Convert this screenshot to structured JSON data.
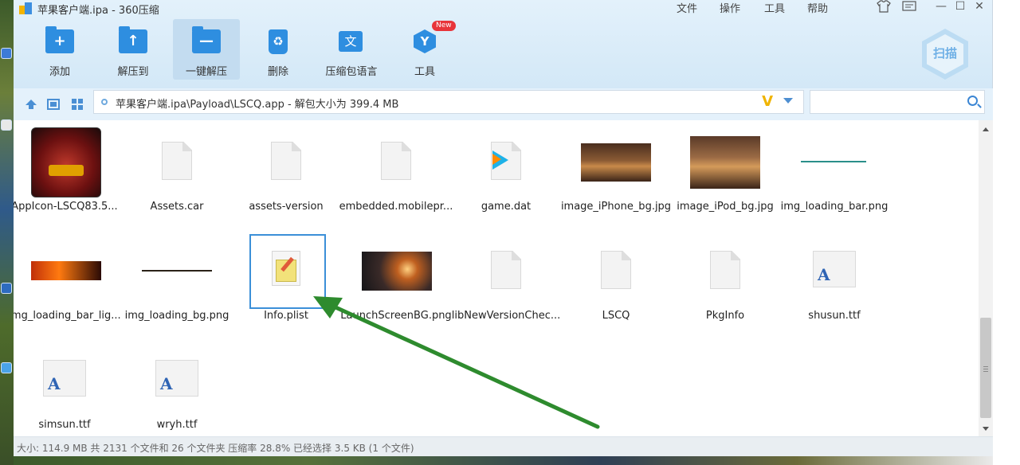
{
  "window": {
    "title": "苹果客户端.ipa - 360压缩",
    "menu": [
      "文件",
      "操作",
      "工具",
      "帮助"
    ]
  },
  "toolbar": {
    "items": [
      {
        "label": "添加",
        "icon": "add-folder-icon",
        "symbol": "+"
      },
      {
        "label": "解压到",
        "icon": "extract-to-icon",
        "symbol": "↑"
      },
      {
        "label": "一键解压",
        "icon": "one-click-extract-icon",
        "symbol": "—"
      },
      {
        "label": "删除",
        "icon": "delete-icon",
        "symbol": "♻"
      },
      {
        "label": "压缩包语言",
        "icon": "language-icon",
        "symbol": "文"
      },
      {
        "label": "工具",
        "icon": "tools-icon",
        "symbol": "Y",
        "badge": "New"
      }
    ],
    "scan_label": "扫描"
  },
  "address": {
    "path": "苹果客户端.ipa\\Payload\\LSCQ.app - 解包大小为 399.4 MB",
    "search_placeholder": ""
  },
  "files": [
    {
      "name": "AppIcon-LSCQ83.5...",
      "type": "app-icon"
    },
    {
      "name": "Assets.car",
      "type": "doc"
    },
    {
      "name": "assets-version",
      "type": "doc"
    },
    {
      "name": "embedded.mobilepr...",
      "type": "doc"
    },
    {
      "name": "game.dat",
      "type": "vcd"
    },
    {
      "name": "image_iPhone_bg.jpg",
      "type": "image"
    },
    {
      "name": "image_iPod_bg.jpg",
      "type": "image"
    },
    {
      "name": "img_loading_bar.png",
      "type": "bar-teal"
    },
    {
      "name": "img_loading_bar_lig...",
      "type": "bar-light"
    },
    {
      "name": "img_loading_bg.png",
      "type": "bar-dark"
    },
    {
      "name": "Info.plist",
      "type": "plist",
      "selected": true
    },
    {
      "name": "LaunchScreenBG.png",
      "type": "launch"
    },
    {
      "name": "libNewVersionChec...",
      "type": "doc"
    },
    {
      "name": "LSCQ",
      "type": "doc"
    },
    {
      "name": "PkgInfo",
      "type": "doc"
    },
    {
      "name": "shusun.ttf",
      "type": "font"
    },
    {
      "name": "simsun.ttf",
      "type": "font"
    },
    {
      "name": "wryh.ttf",
      "type": "font"
    }
  ],
  "status": "大小: 114.9 MB 共 2131 个文件和 26 个文件夹 压缩率 28.8% 已经选择 3.5 KB (1 个文件)",
  "colors": {
    "accent": "#2e8ee0",
    "selection_border": "#3b8fd8",
    "annotation_arrow": "#2e8b2e",
    "badge": "#e8343a"
  }
}
